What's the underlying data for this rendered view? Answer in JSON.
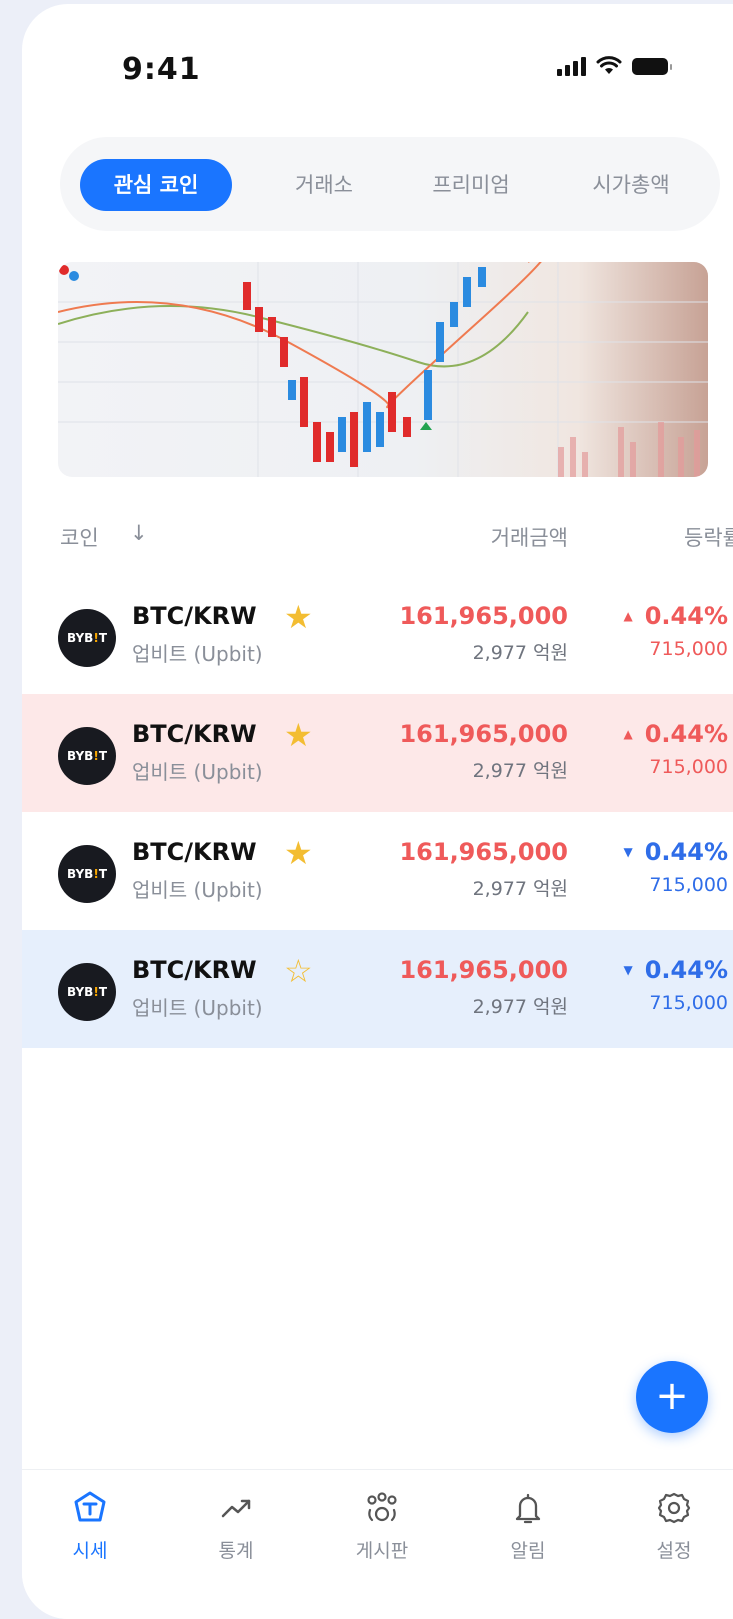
{
  "status_bar": {
    "time": "9:41"
  },
  "tabs": [
    {
      "label": "관심 코인",
      "active": true
    },
    {
      "label": "거래소",
      "active": false
    },
    {
      "label": "프리미엄",
      "active": false
    },
    {
      "label": "시가총액",
      "active": false
    }
  ],
  "list_header": {
    "coin": "코인",
    "sort_icon": "arrow-down-icon",
    "volume": "거래금액",
    "rate": "등락률"
  },
  "rows": [
    {
      "logo": "BYBIT",
      "pair": "BTC/KRW",
      "starred": true,
      "exchange": "업비트 (Upbit)",
      "price": "161,965,000",
      "volume": "2,977 억원",
      "rate": "0.44%",
      "change": "715,000",
      "direction": "up",
      "highlight": "none"
    },
    {
      "logo": "BYBIT",
      "pair": "BTC/KRW",
      "starred": true,
      "exchange": "업비트 (Upbit)",
      "price": "161,965,000",
      "volume": "2,977 억원",
      "rate": "0.44%",
      "change": "715,000",
      "direction": "up",
      "highlight": "red"
    },
    {
      "logo": "BYBIT",
      "pair": "BTC/KRW",
      "starred": true,
      "exchange": "업비트 (Upbit)",
      "price": "161,965,000",
      "volume": "2,977 억원",
      "rate": "0.44%",
      "change": "715,000",
      "direction": "down",
      "highlight": "none"
    },
    {
      "logo": "BYBIT",
      "pair": "BTC/KRW",
      "starred": false,
      "exchange": "업비트 (Upbit)",
      "price": "161,965,000",
      "volume": "2,977 억원",
      "rate": "0.44%",
      "change": "715,000",
      "direction": "down",
      "highlight": "blue"
    }
  ],
  "fab": {
    "icon": "plus-icon",
    "label": "+"
  },
  "nav": [
    {
      "label": "시세",
      "icon": "market-icon",
      "active": true
    },
    {
      "label": "통계",
      "icon": "trend-icon",
      "active": false
    },
    {
      "label": "게시판",
      "icon": "community-icon",
      "active": false
    },
    {
      "label": "알림",
      "icon": "bell-icon",
      "active": false
    },
    {
      "label": "설정",
      "icon": "gear-icon",
      "active": false
    }
  ],
  "colors": {
    "accent": "#1a75ff",
    "up": "#ef5a5a",
    "down": "#2f6de8",
    "star": "#f3bd32",
    "highlight_red": "#fde8e8",
    "highlight_blue": "#e6effc"
  }
}
